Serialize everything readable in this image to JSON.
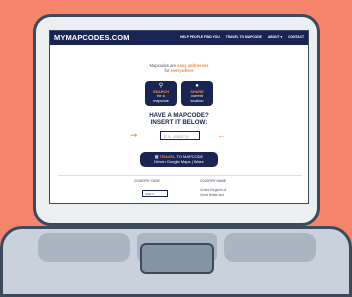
{
  "site": {
    "logo_prefix": "MY",
    "logo_rest": "MAPCODES.COM",
    "nav_links": [
      "HELP PEOPLE FIND YOU",
      "TRAVEL TO MAPCODE",
      "ABOUT ▾",
      "CONTACT"
    ]
  },
  "hero": {
    "tagline_1": "Mapcodes are ",
    "tagline_hl1": "easy addresses",
    "tagline_2": "for ",
    "tagline_hl2": "everywhere",
    "search_tile": {
      "icon": "search-icon",
      "kw": "SEARCH",
      "line2": "for a",
      "line3": "mapcode"
    },
    "share_tile": {
      "icon": "location-icon",
      "kw": "SHARE",
      "line2": "current",
      "line3": "location"
    }
  },
  "insert": {
    "line1": "HAVE A MAPCODE?",
    "line2": "INSERT IT BELOW:",
    "placeholder": "E.G. 49DD.3J"
  },
  "travel_button": {
    "kw": "TRAVEL",
    "rest": " TO MAPCODE",
    "line2": "Driven Google Maps | Waze"
  },
  "table": {
    "country_code_label": "COUNTRY CODE",
    "country_name_label": "COUNTRY NAME",
    "selected_code": "GBR",
    "country_name_line1": "United Kingdom of",
    "country_name_line2": "Great Britain and"
  },
  "colors": {
    "navy": "#1a2452",
    "accent": "#f08a3e",
    "background": "#f4856a"
  }
}
